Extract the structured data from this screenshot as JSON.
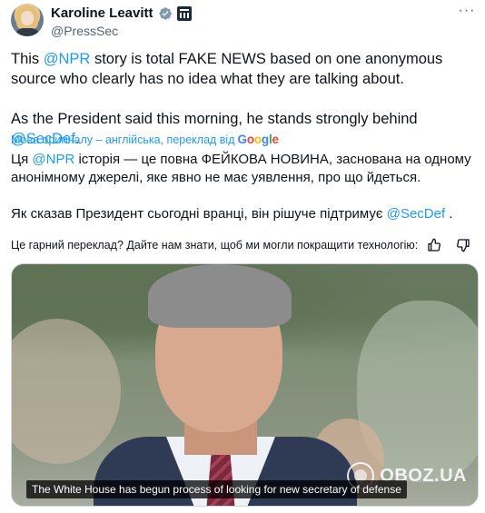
{
  "author": {
    "name": "Karoline Leavitt",
    "handle": "@PressSec"
  },
  "tweet": {
    "line1_before": "This ",
    "line1_mention": "@NPR",
    "line1_after": " story is total FAKE NEWS based on one anonymous source who clearly has no idea what they are talking about.",
    "line2_before": "As the President said this morning, he stands strongly behind ",
    "line2_mention": "@SecDef",
    "line2_after": "."
  },
  "translation": {
    "note_prefix": "Мова оригіналу – англійська, переклад від",
    "provider_letters": [
      "G",
      "o",
      "o",
      "g",
      "l",
      "e"
    ],
    "line1_before": "Ця ",
    "line1_mention": "@NPR",
    "line1_after": " історія — це повна ФЕЙКОВА НОВИНА, заснована на одному анонімному джерелі, яке явно не має уявлення, про що йдеться.",
    "line2_before": "Як сказав Президент сьогодні вранці, він рішуче підтримує ",
    "line2_mention": "@SecDef",
    "line2_after": " ."
  },
  "feedback": {
    "question": "Це гарний переклад? Дайте нам знати, щоб ми могли покращити технологію:"
  },
  "media": {
    "caption": "The White House has begun process of looking for new secretary of defense",
    "watermark": "OBOZ.UA"
  },
  "icons": {
    "verified": "verified-badge-icon",
    "government": "government-building-icon",
    "more": "more-options-icon",
    "thumbs_up": "thumbs-up-icon",
    "thumbs_down": "thumbs-down-icon"
  },
  "colors": {
    "accent": "#1d9bf0",
    "text": "#0f1419",
    "secondary": "#536471"
  }
}
